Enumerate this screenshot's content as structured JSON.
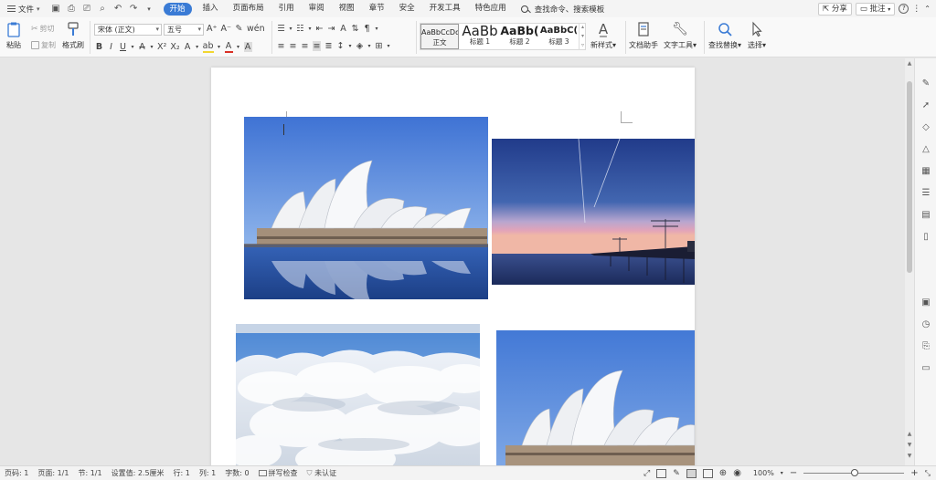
{
  "menubar": {
    "file_label": "文件",
    "tabs": [
      "开始",
      "插入",
      "页面布局",
      "引用",
      "审阅",
      "视图",
      "章节",
      "安全",
      "开发工具",
      "特色应用"
    ],
    "active_tab": "开始",
    "search_label": "查找命令、搜索模板",
    "share_label": "分享",
    "comment_label": "批注",
    "help_label": "?"
  },
  "ribbon": {
    "paste_label": "粘贴",
    "cut_label": "剪切",
    "copy_label": "复制",
    "format_painter_label": "格式刷",
    "font_name": "宋体 (正文)",
    "font_size": "五号",
    "styles": [
      {
        "preview": "AaBbCcDd",
        "label": "正文"
      },
      {
        "preview": "AaBb",
        "label": "标题 1"
      },
      {
        "preview": "AaBb(",
        "label": "标题 2"
      },
      {
        "preview": "AaBbC(",
        "label": "标题 3"
      }
    ],
    "new_style_label": "新样式",
    "doc_assistant_label": "文档助手",
    "text_tools_label": "文字工具",
    "find_replace_label": "查找替换",
    "select_label": "选择"
  },
  "statusbar": {
    "page_no": "页码: 1",
    "pages": "页面: 1/1",
    "section": "节: 1/1",
    "setting": "设置值: 2.5厘米",
    "row": "行: 1",
    "col": "列: 1",
    "word_count": "字数: 0",
    "spell_check": "拼写检查",
    "cert": "未认证",
    "zoom": "100%",
    "zoom_minus": "−",
    "zoom_plus": "+"
  },
  "colors": {
    "accent": "#3a7bd5",
    "sky_blue": "#4f83d8",
    "dusk_top": "#27418f",
    "dusk_horizon": "#e3a4b8"
  }
}
